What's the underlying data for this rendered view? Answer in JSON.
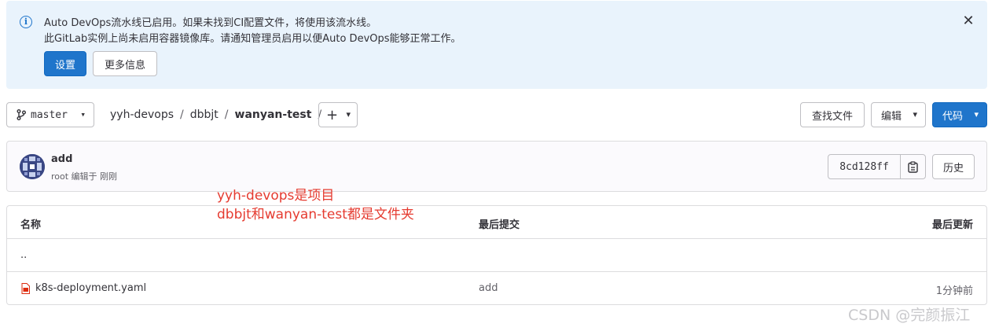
{
  "alert": {
    "line1": "Auto DevOps流水线已启用。如果未找到CI配置文件，将使用该流水线。",
    "line2": "此GitLab实例上尚未启用容器镜像库。请通知管理员启用以便Auto DevOps能够正常工作。",
    "primary_button": "设置",
    "secondary_button": "更多信息",
    "close_symbol": "✕"
  },
  "toolbar": {
    "branch": "master",
    "breadcrumbs": [
      "yyh-devops",
      "dbbjt",
      "wanyan-test"
    ],
    "separator": "/",
    "add_symbol": "+",
    "find_file_button": "查找文件",
    "edit_button": "编辑",
    "code_button": "代码"
  },
  "commit": {
    "title": "add",
    "meta": "root 编辑于 刚刚",
    "sha": "8cd128ff",
    "history_button": "历史"
  },
  "annotation": {
    "line1": "yyh-devops是项目",
    "line2": "dbbjt和wanyan-test都是文件夹"
  },
  "files": {
    "columns": {
      "name": "名称",
      "last_commit": "最后提交",
      "last_update": "最后更新"
    },
    "parent_dir": "..",
    "rows": [
      {
        "name": "k8s-deployment.yaml",
        "last_commit": "add",
        "last_update": "1分钟前"
      }
    ]
  },
  "watermark": "CSDN @完颜振江",
  "colors": {
    "primary": "#1f75cb",
    "alert_bg": "#e9f3fc",
    "annotation": "#e53b30",
    "file_icon": "#dd2b0e"
  }
}
